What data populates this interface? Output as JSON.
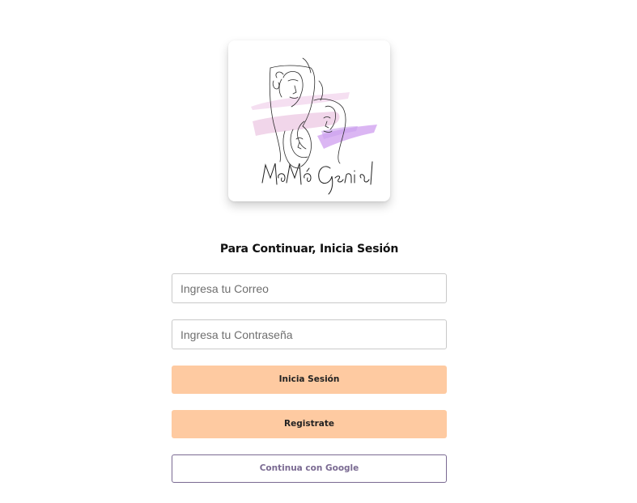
{
  "brand": {
    "logo_text": "MaMá Genial",
    "colors": {
      "pink_stroke": "#f0d3e8",
      "lilac_stroke": "#d8b3f0",
      "ink": "#2a2a2a"
    }
  },
  "login": {
    "title": "Para Continuar, Inicia Sesión",
    "email_placeholder": "Ingresa tu Correo",
    "email_value": "",
    "password_placeholder": "Ingresa tu Contraseña",
    "password_value": "",
    "login_button": "Inicia Sesión",
    "register_button": "Registrate",
    "google_button": "Continua con Google",
    "accent_color": "#fecaa1",
    "google_color": "#7a6a92"
  }
}
